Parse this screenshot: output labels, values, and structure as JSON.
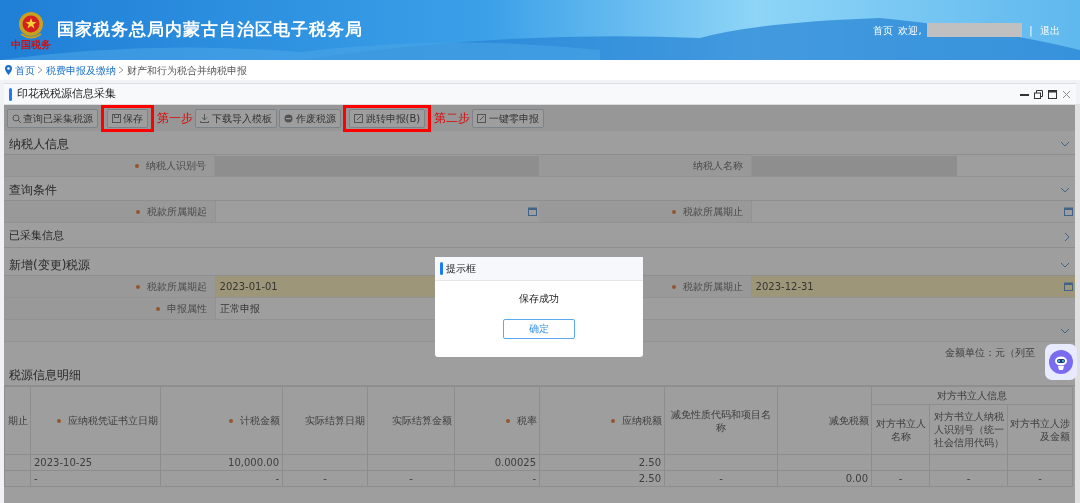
{
  "header": {
    "title": "国家税务总局内蒙古自治区电子税务局",
    "logo_caption": "中国税务",
    "home": "首页",
    "welcome": "欢迎,",
    "separator": "|",
    "logout": "退出"
  },
  "breadcrumb": [
    {
      "label": "首页",
      "link": true
    },
    {
      "label": "税费申报及缴纳",
      "link": true
    },
    {
      "label": "财产和行为税合并纳税申报",
      "link": false
    }
  ],
  "panel": {
    "title": "印花税税源信息采集"
  },
  "toolbar": [
    {
      "label": "查询已采集税源",
      "kind": "search",
      "highlighted": false
    },
    {
      "label": "保存",
      "kind": "save",
      "highlighted": true,
      "note": "第一步"
    },
    {
      "label": "下载导入模板",
      "kind": "download",
      "highlighted": false
    },
    {
      "label": "作废税源",
      "kind": "void",
      "highlighted": false
    },
    {
      "label": "跳转申报(B)",
      "kind": "edit",
      "highlighted": true,
      "note": "第二步"
    },
    {
      "label": "一键零申报",
      "kind": "edit",
      "highlighted": false
    }
  ],
  "sections": [
    {
      "title": "纳税人信息",
      "expanded": true,
      "rows": [
        [
          {
            "label": "纳税人识别号",
            "required": true,
            "kind": "readonly"
          },
          {
            "label": "纳税人名称",
            "required": false,
            "kind": "readonly"
          }
        ]
      ]
    },
    {
      "title": "查询条件",
      "expanded": true,
      "rows": [
        [
          {
            "label": "税款所属期起",
            "required": true,
            "kind": "date",
            "highlighted": false
          },
          {
            "label": "税款所属期止",
            "required": true,
            "kind": "date",
            "highlighted": false
          }
        ]
      ]
    },
    {
      "title": "已采集信息",
      "expanded": false
    },
    {
      "title": "新增(变更)税源",
      "expanded": true,
      "rows": [
        [
          {
            "label": "税款所属期起",
            "required": true,
            "kind": "date",
            "value": "2023-01-01",
            "highlighted": true
          },
          {
            "label": "税款所属期止",
            "required": true,
            "kind": "date",
            "value": "2023-12-31",
            "highlighted": true
          }
        ],
        [
          {
            "label": "申报属性",
            "required": true,
            "kind": "text",
            "value": "正常申报"
          }
        ]
      ],
      "subsection": {
        "expanded": true
      },
      "unit_note": "金额单位：元（列至"
    }
  ],
  "detail": {
    "title": "税源信息明细",
    "expanded": true,
    "columns": [
      {
        "label": "期止",
        "required": false
      },
      {
        "label": "应纳税凭证书立日期",
        "required": true
      },
      {
        "label": "计税金额",
        "required": true
      },
      {
        "label": "实际结算日期",
        "required": false
      },
      {
        "label": "实际结算金额",
        "required": false
      },
      {
        "label": "税率",
        "required": true
      },
      {
        "label": "应纳税额",
        "required": true
      },
      {
        "label": "减免性质代码和项目名称",
        "required": false
      },
      {
        "label": "减免税额",
        "required": false
      },
      {
        "label": "对方书立人信息",
        "colspan": 3,
        "children": [
          {
            "label": "对方书立人名称",
            "required": false
          },
          {
            "label": "对方书立人纳税人识别号（统一社会信用代码）",
            "required": false
          },
          {
            "label": "对方书立人涉及金额",
            "required": false
          }
        ]
      }
    ],
    "rows": [
      [
        null,
        "2023-10-25",
        "10,000.00",
        null,
        null,
        "0.00025",
        "2.50",
        null,
        null,
        null,
        null,
        null
      ],
      [
        null,
        "-",
        "-",
        "-",
        "-",
        "-",
        "2.50",
        "-",
        "0.00",
        "-",
        "-",
        "-"
      ]
    ]
  },
  "dialog": {
    "title": "提示框",
    "message": "保存成功",
    "button": "确定"
  }
}
